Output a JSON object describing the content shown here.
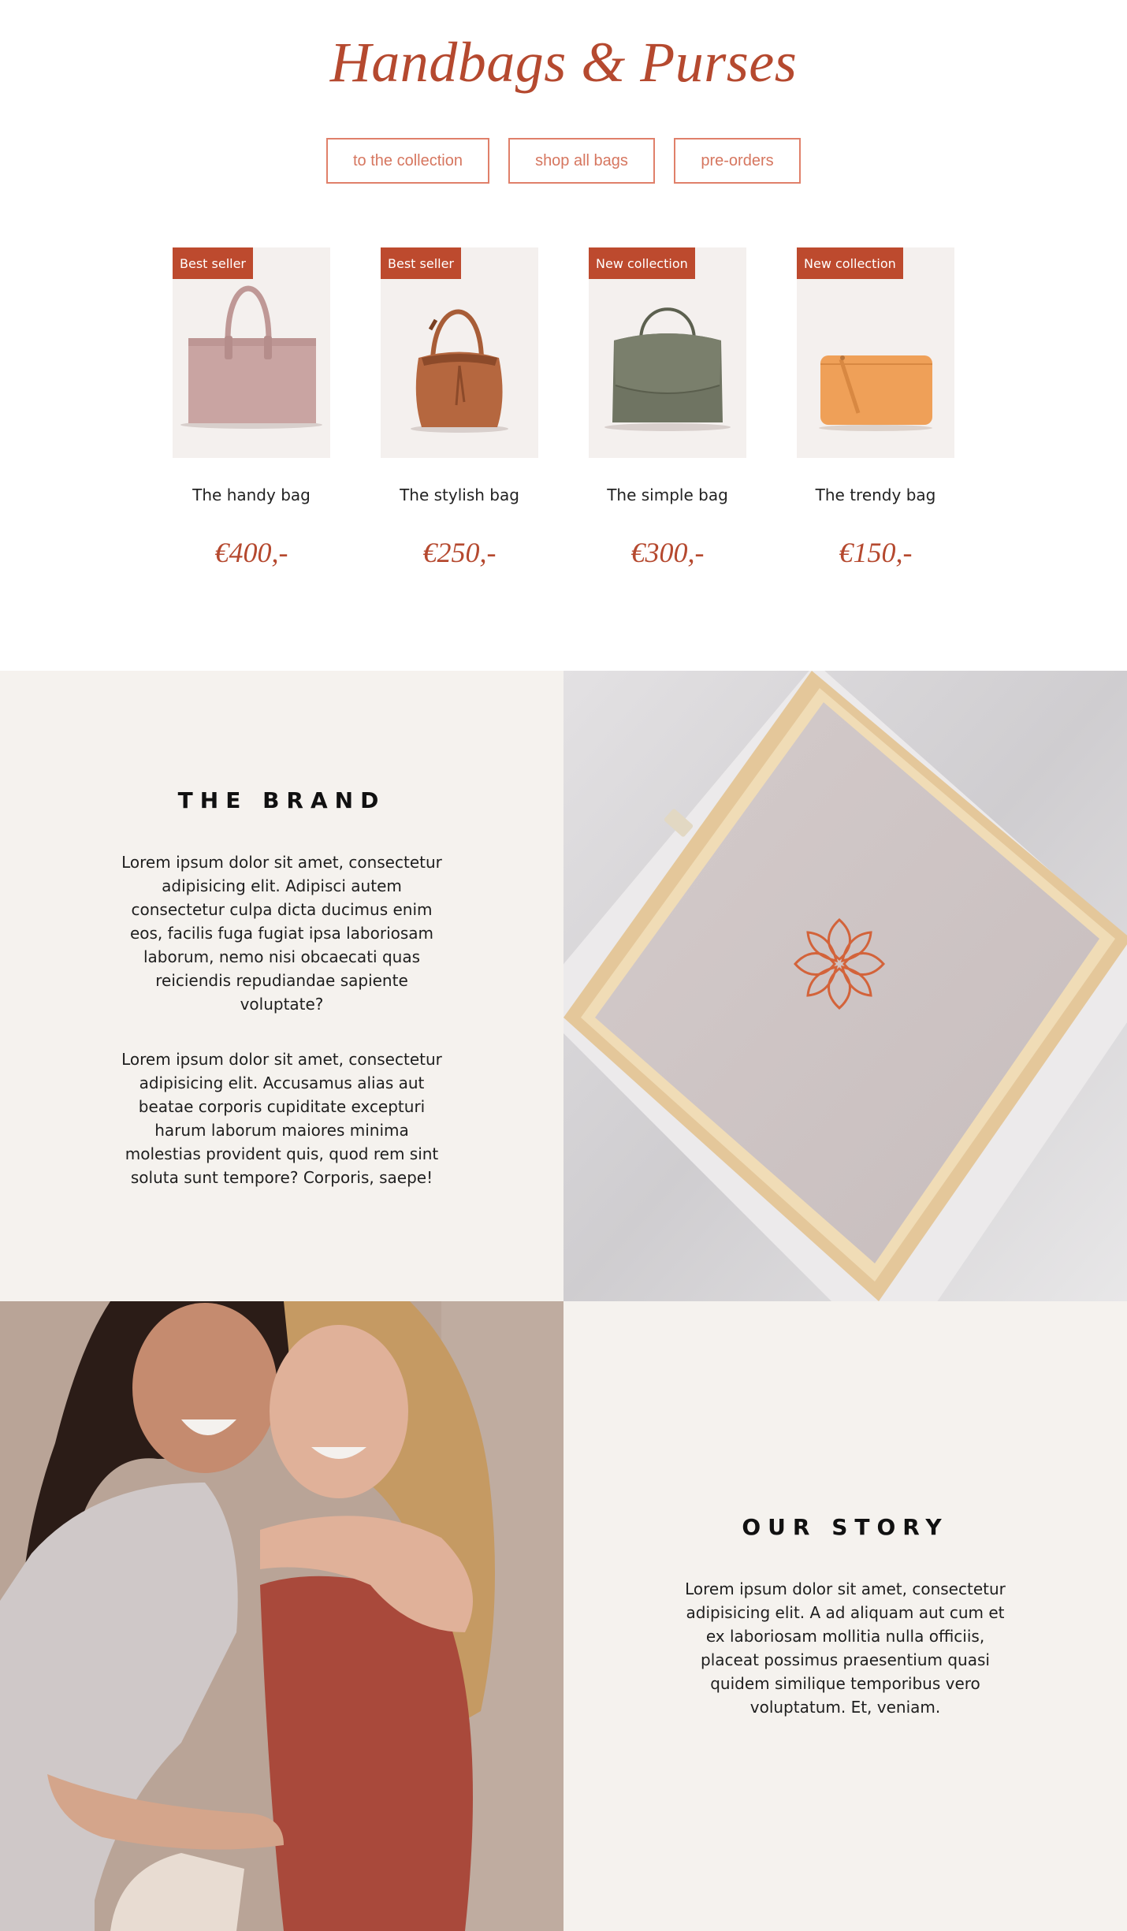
{
  "page": {
    "title": "Handbags & Purses"
  },
  "nav": {
    "collection": "to the collection",
    "shop_all": "shop all bags",
    "pre_orders": "pre-orders"
  },
  "products": [
    {
      "badge": "Best seller",
      "name": "The handy bag",
      "price": "€400,-",
      "bag_color": "#c9a4a2"
    },
    {
      "badge": "Best seller",
      "name": "The stylish bag",
      "price": "€250,-",
      "bag_color": "#b5673f"
    },
    {
      "badge": "New collection",
      "name": "The simple bag",
      "price": "€300,-",
      "bag_color": "#6f7462"
    },
    {
      "badge": "New collection",
      "name": "The trendy bag",
      "price": "€150,-",
      "bag_color": "#efa058"
    }
  ],
  "brand": {
    "heading": "THE BRAND",
    "paragraph1": "Lorem ipsum dolor sit amet, consectetur adipisicing elit. Adipisci autem consectetur culpa dicta ducimus enim eos, facilis fuga fugiat ipsa laboriosam laborum, nemo nisi obcaecati quas reiciendis repudiandae sapiente voluptate?",
    "paragraph2": "Lorem ipsum dolor sit amet, consectetur adipisicing elit. Accusamus alias aut beatae corporis cupiditate excepturi harum laborum maiores minima molestias provident quis, quod rem sint soluta sunt tempore? Corporis, saepe!"
  },
  "story": {
    "heading": "OUR STORY",
    "paragraph": "Lorem ipsum dolor sit amet, consectetur adipisicing elit. A ad aliquam aut cum et ex laboriosam mollitia nulla officiis, placeat possimus praesentium quasi quidem similique temporibus vero voluptatum. Et, veniam."
  },
  "colors": {
    "accent": "#b5492f",
    "button_border": "#e0806a",
    "panel_bg": "#f5f2ee",
    "badge_bg": "#bd4a2e"
  }
}
